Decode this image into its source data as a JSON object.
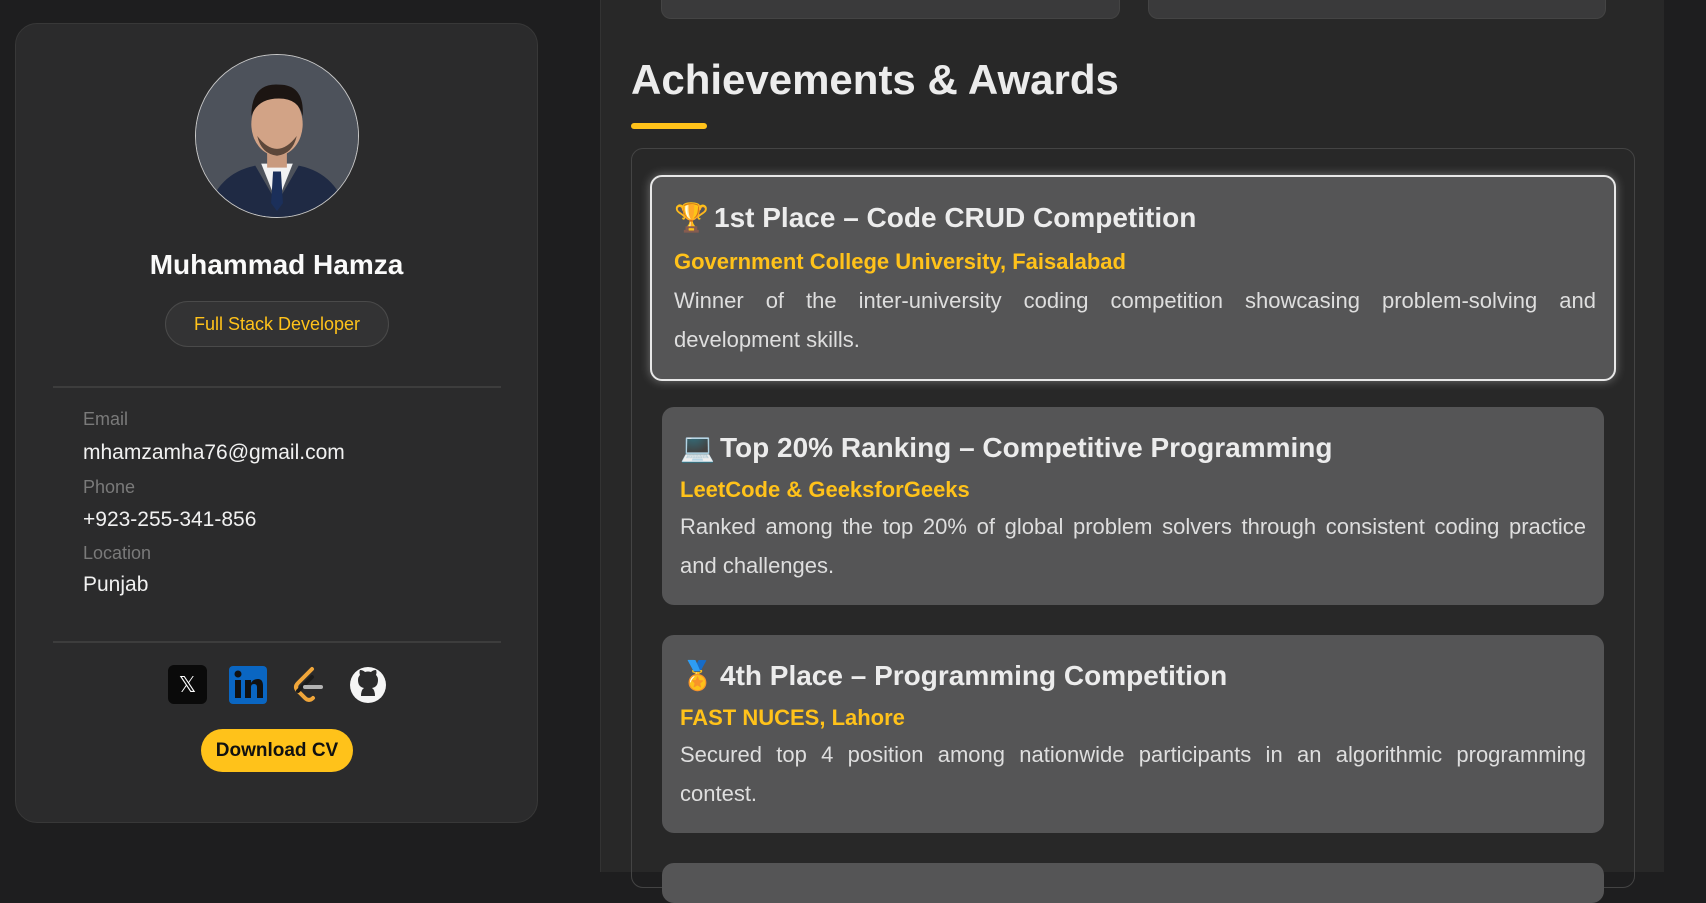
{
  "profile": {
    "name": "Muhammad Hamza",
    "role": "Full Stack Developer",
    "contacts": [
      {
        "label": "Email",
        "value": "mhamzamha76@gmail.com"
      },
      {
        "label": "Phone",
        "value": "+923-255-341-856"
      },
      {
        "label": "Location",
        "value": "Punjab"
      }
    ],
    "socials": [
      "x-icon",
      "linkedin-icon",
      "leetcode-icon",
      "github-icon"
    ],
    "download_label": "Download CV"
  },
  "section": {
    "title": "Achievements & Awards",
    "items": [
      {
        "icon": "trophy-icon",
        "emoji": "🏆",
        "title": "1st Place – Code CRUD Competition",
        "org": "Government College University, Faisalabad",
        "desc": "Winner of the inter-university coding competition showcasing problem-solving and development skills."
      },
      {
        "icon": "laptop-icon",
        "emoji": "💻",
        "title": "Top 20% Ranking – Competitive Programming",
        "org": "LeetCode & GeeksforGeeks",
        "desc": "Ranked among the top 20% of global problem solvers through consistent coding practice and challenges."
      },
      {
        "icon": "medal-icon",
        "emoji": "🏅",
        "title": "4th Place – Programming Competition",
        "org": "FAST NUCES, Lahore",
        "desc": "Secured top 4 position among nationwide participants in an algorithmic programming contest."
      }
    ]
  },
  "colors": {
    "accent": "#ffc21a",
    "background": "#1e1e1f",
    "card": "#555556",
    "panel": "#2b2b2c"
  }
}
